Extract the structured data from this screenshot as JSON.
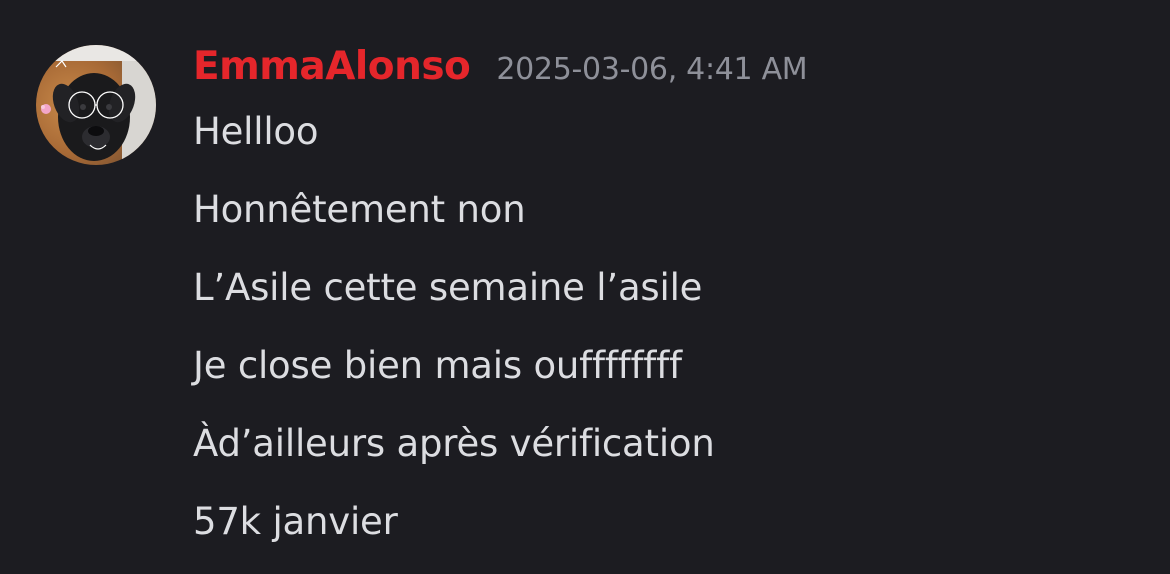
{
  "message": {
    "author": "EmmaAlonso",
    "timestamp": "2025-03-06, 4:41 AM",
    "author_color": "#e5262b",
    "avatar_icon": "dog-avatar-icon",
    "lines": [
      "Hellloo",
      "Honnêtement non",
      "L’Asile cette semaine l’asile",
      "Je close bien mais ouffffffff",
      "Àd’ailleurs après vérification",
      "57k janvier"
    ]
  }
}
